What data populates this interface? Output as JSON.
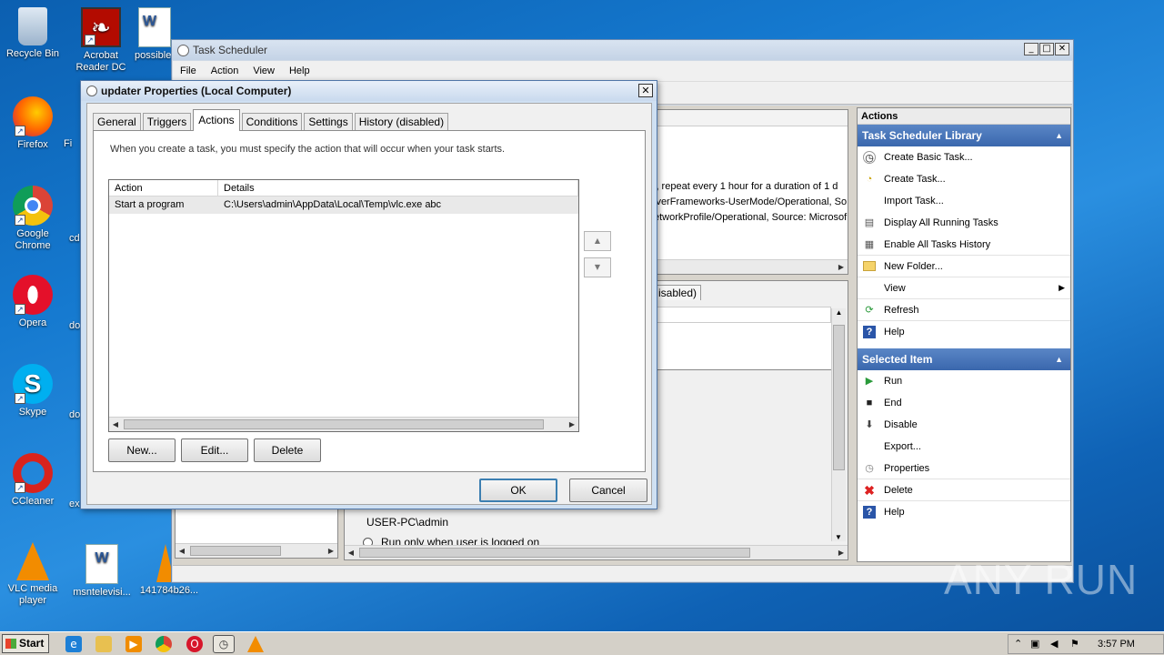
{
  "desktop": {
    "icons": [
      {
        "label": "Recycle Bin"
      },
      {
        "label": "Acrobat Reader DC"
      },
      {
        "label": "possible"
      },
      {
        "label": "Firefox"
      },
      {
        "label": "Fi"
      },
      {
        "label": "Google Chrome"
      },
      {
        "label": "cd"
      },
      {
        "label": "Opera"
      },
      {
        "label": "do"
      },
      {
        "label": "Skype"
      },
      {
        "label": "do"
      },
      {
        "label": "CCleaner"
      },
      {
        "label": "ex"
      },
      {
        "label": "VLC media player"
      },
      {
        "label": "msntelevisi..."
      },
      {
        "label": "141784b26..."
      }
    ]
  },
  "task_scheduler": {
    "title": "Task Scheduler",
    "menu": [
      "File",
      "Action",
      "View",
      "Help"
    ],
    "center_top_lines": [
      "l, repeat every 1 hour for a duration of 1 d",
      "iverFrameworks-UserMode/Operational, So",
      "etworkProfile/Operational, Source: Microsof"
    ],
    "center_tab_fragment": "isabled)",
    "user_account": "USER-PC\\admin",
    "run_option": "Run only when user is logged on",
    "actions_pane": {
      "title": "Actions",
      "section1": "Task Scheduler Library",
      "section1_items": [
        "Create Basic Task...",
        "Create Task...",
        "Import Task...",
        "Display All Running Tasks",
        "Enable All Tasks History",
        "New Folder...",
        "View",
        "Refresh",
        "Help"
      ],
      "section2": "Selected Item",
      "section2_items": [
        "Run",
        "End",
        "Disable",
        "Export...",
        "Properties",
        "Delete",
        "Help"
      ]
    }
  },
  "dialog": {
    "title": "updater Properties (Local Computer)",
    "tabs": [
      "General",
      "Triggers",
      "Actions",
      "Conditions",
      "Settings",
      "History (disabled)"
    ],
    "active_tab": "Actions",
    "description": "When you create a task, you must specify the action that will occur when your task starts.",
    "columns": [
      "Action",
      "Details"
    ],
    "rows": [
      {
        "action": "Start a program",
        "details": "C:\\Users\\admin\\AppData\\Local\\Temp\\vlc.exe abc"
      }
    ],
    "buttons": {
      "new": "New...",
      "edit": "Edit...",
      "delete": "Delete",
      "ok": "OK",
      "cancel": "Cancel"
    }
  },
  "taskbar": {
    "start_label": "Start",
    "clock": "3:57 PM"
  },
  "watermark": "ANY RUN"
}
